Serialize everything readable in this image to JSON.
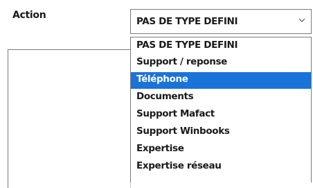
{
  "form": {
    "action_label": "Action"
  },
  "select": {
    "value": "PAS DE TYPE DEFINI",
    "icon": "chevron-down-icon"
  },
  "dropdown": {
    "options": [
      "PAS DE TYPE DEFINI",
      "Support / reponse",
      "Téléphone",
      "Documents",
      "Support Mafact",
      "Support Winbooks",
      "Expertise",
      "Expertise réseau"
    ],
    "highlighted": "Téléphone"
  },
  "colors": {
    "highlight": "#1a73d9",
    "border": "#7a7a7a"
  }
}
